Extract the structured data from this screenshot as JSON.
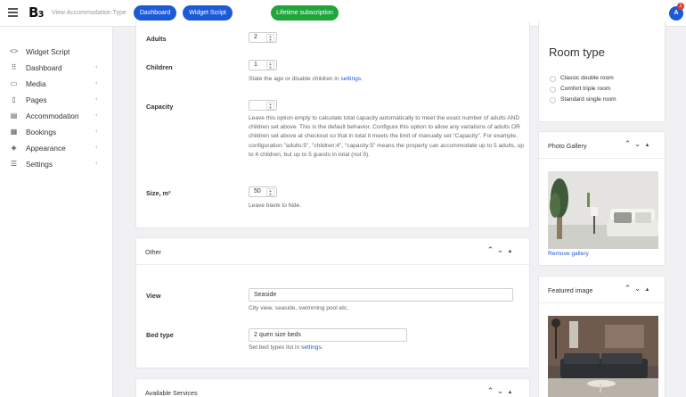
{
  "topbar": {
    "logo": "B",
    "view_label": "View Accommodation Type",
    "dashboard_btn": "Dashboard",
    "widget_btn": "Widget Script",
    "lifetime_btn": "Lifetime subscription",
    "avatar": "A",
    "notification_count": "2"
  },
  "sidebar": {
    "items": [
      {
        "label": "Widget Script",
        "icon": "code-icon"
      },
      {
        "label": "Dashboard",
        "icon": "grid-icon"
      },
      {
        "label": "Media",
        "icon": "image-icon"
      },
      {
        "label": "Pages",
        "icon": "page-icon"
      },
      {
        "label": "Accommodation",
        "icon": "building-icon"
      },
      {
        "label": "Bookings",
        "icon": "calendar-icon"
      },
      {
        "label": "Appearance",
        "icon": "paint-icon"
      },
      {
        "label": "Settings",
        "icon": "sliders-icon"
      }
    ]
  },
  "main": {
    "adults_label": "Adults",
    "adults_value": "2",
    "children_label": "Children",
    "children_value": "1",
    "children_help_pre": "State the age or disable children in ",
    "children_help_link": "settings",
    "children_help_post": ".",
    "capacity_label": "Capacity",
    "capacity_value": "",
    "capacity_help": "Leave this option empty to calculate total capacity automatically to meet the exact number of adults AND children set above. This is the default behavior. Configure this option to allow any variations of adults OR children set above at checkout so that in total it meets the limit of manually set \"Capacity\". For example, configuration \"adults:5\", \"children:4\", \"capacity:5\" means the property can accommodate up to 5 adults, up to 4 children, but up to 5 guests in total (not 9).",
    "size_label": "Size, m²",
    "size_value": "50",
    "size_help": "Leave blank to hide.",
    "other_title": "Other",
    "view_label": "View",
    "view_value": "Seaside",
    "view_help": "City view, seaside, swimming pool etc.",
    "bed_label": "Bed type",
    "bed_value": "2 quen size beds",
    "bed_help_pre": "Set bed types list in ",
    "bed_help_link": "settings",
    "bed_help_post": ".",
    "services_title": "Available Services"
  },
  "right": {
    "room_type_title": "Room type",
    "room_types": [
      "Classic double room",
      "Comfort triple room",
      "Standard single room"
    ],
    "gallery_title": "Photo Gallery",
    "remove_gallery": "Remove gallery",
    "featured_title": "Featured image"
  }
}
